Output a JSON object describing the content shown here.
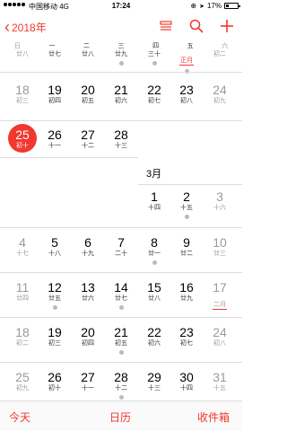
{
  "status": {
    "carrier": "中国移动",
    "network": "4G",
    "time": "17:24",
    "battery": "17%"
  },
  "nav": {
    "back_label": "2018年",
    "icons": [
      "list-icon",
      "search-icon",
      "add-icon"
    ]
  },
  "weekdays": [
    "日",
    "一",
    "二",
    "三",
    "四",
    "五",
    "六"
  ],
  "top_partial_row": [
    "廿八",
    "廿七",
    "廿八",
    "廿九",
    "三十",
    "正月",
    "初二"
  ],
  "february": {
    "rows": [
      [
        {
          "d": "18",
          "l": "初三"
        },
        {
          "d": "19",
          "l": "初四"
        },
        {
          "d": "20",
          "l": "初五"
        },
        {
          "d": "21",
          "l": "初六"
        },
        {
          "d": "22",
          "l": "初七"
        },
        {
          "d": "23",
          "l": "初八"
        },
        {
          "d": "24",
          "l": "初九"
        }
      ],
      [
        {
          "d": "25",
          "l": "初十"
        },
        {
          "d": "26",
          "l": "十一"
        },
        {
          "d": "27",
          "l": "十二"
        },
        {
          "d": "28",
          "l": "十三"
        }
      ]
    ]
  },
  "march": {
    "label": "3月",
    "rows": [
      [
        {
          "d": "1",
          "l": "十四"
        },
        {
          "d": "2",
          "l": "十五"
        },
        {
          "d": "3",
          "l": "十六"
        }
      ],
      [
        {
          "d": "4",
          "l": "十七"
        },
        {
          "d": "5",
          "l": "十八"
        },
        {
          "d": "6",
          "l": "十九"
        },
        {
          "d": "7",
          "l": "二十"
        },
        {
          "d": "8",
          "l": "廿一"
        },
        {
          "d": "9",
          "l": "廿二"
        },
        {
          "d": "10",
          "l": "廿三"
        }
      ],
      [
        {
          "d": "11",
          "l": "廿四"
        },
        {
          "d": "12",
          "l": "廿五"
        },
        {
          "d": "13",
          "l": "廿六"
        },
        {
          "d": "14",
          "l": "廿七"
        },
        {
          "d": "15",
          "l": "廿八"
        },
        {
          "d": "16",
          "l": "廿九"
        },
        {
          "d": "17",
          "l": "二月"
        }
      ],
      [
        {
          "d": "18",
          "l": "初二"
        },
        {
          "d": "19",
          "l": "初三"
        },
        {
          "d": "20",
          "l": "初四"
        },
        {
          "d": "21",
          "l": "初五"
        },
        {
          "d": "22",
          "l": "初六"
        },
        {
          "d": "23",
          "l": "初七"
        },
        {
          "d": "24",
          "l": "初八"
        }
      ],
      [
        {
          "d": "25",
          "l": "初九"
        },
        {
          "d": "26",
          "l": "初十"
        },
        {
          "d": "27",
          "l": "十一"
        },
        {
          "d": "28",
          "l": "十二"
        },
        {
          "d": "29",
          "l": "十三"
        },
        {
          "d": "30",
          "l": "十四"
        },
        {
          "d": "31",
          "l": "十五"
        }
      ]
    ]
  },
  "tabbar": {
    "today": "今天",
    "calendars": "日历",
    "inbox": "收件箱"
  },
  "colors": {
    "accent": "#f0382f"
  }
}
